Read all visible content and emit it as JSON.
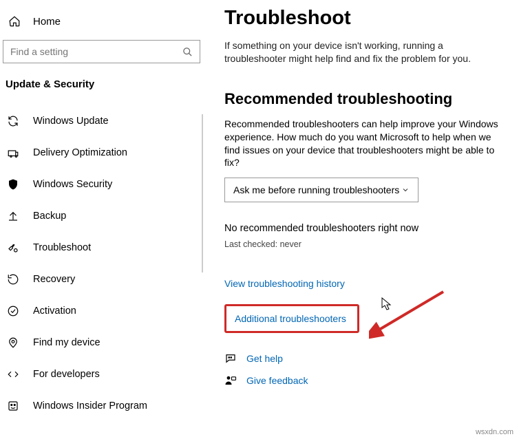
{
  "sidebar": {
    "home": "Home",
    "search_placeholder": "Find a setting",
    "section": "Update & Security",
    "items": [
      {
        "label": "Windows Update"
      },
      {
        "label": "Delivery Optimization"
      },
      {
        "label": "Windows Security"
      },
      {
        "label": "Backup"
      },
      {
        "label": "Troubleshoot"
      },
      {
        "label": "Recovery"
      },
      {
        "label": "Activation"
      },
      {
        "label": "Find my device"
      },
      {
        "label": "For developers"
      },
      {
        "label": "Windows Insider Program"
      }
    ]
  },
  "main": {
    "title": "Troubleshoot",
    "intro": "If something on your device isn't working, running a troubleshooter might help find and fix the problem for you.",
    "recommended_heading": "Recommended troubleshooting",
    "recommended_desc": "Recommended troubleshooters can help improve your Windows experience. How much do you want Microsoft to help when we find issues on your device that troubleshooters might be able to fix?",
    "dropdown_selected": "Ask me before running troubleshooters",
    "no_recommended": "No recommended troubleshooters right now",
    "last_checked": "Last checked: never",
    "link_history": "View troubleshooting history",
    "link_additional": "Additional troubleshooters",
    "link_get_help": "Get help",
    "link_give_feedback": "Give feedback"
  },
  "watermark": "wsxdn.com"
}
